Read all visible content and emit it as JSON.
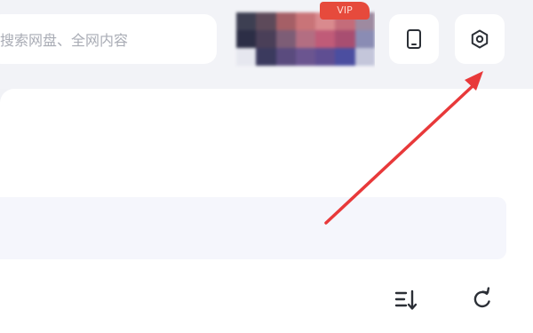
{
  "search": {
    "placeholder": "搜索网盘、全网内容",
    "icon": "search-icon"
  },
  "vip_badge": {
    "text": "VIP"
  },
  "header_actions": [
    {
      "name": "tablet-icon"
    },
    {
      "name": "settings-gear-icon"
    }
  ],
  "toolbar": {
    "sort_icon": "sort-icon",
    "refresh_icon": "refresh-icon"
  },
  "colors": {
    "background": "#f1f2f6",
    "card": "#ffffff",
    "banner": "#f5f6fc",
    "icon": "#2b2f36",
    "annotation": "#e8393a",
    "vip_badge": "#e64a3c"
  },
  "annotation": {
    "type": "arrow",
    "points_to": "settings-button"
  }
}
